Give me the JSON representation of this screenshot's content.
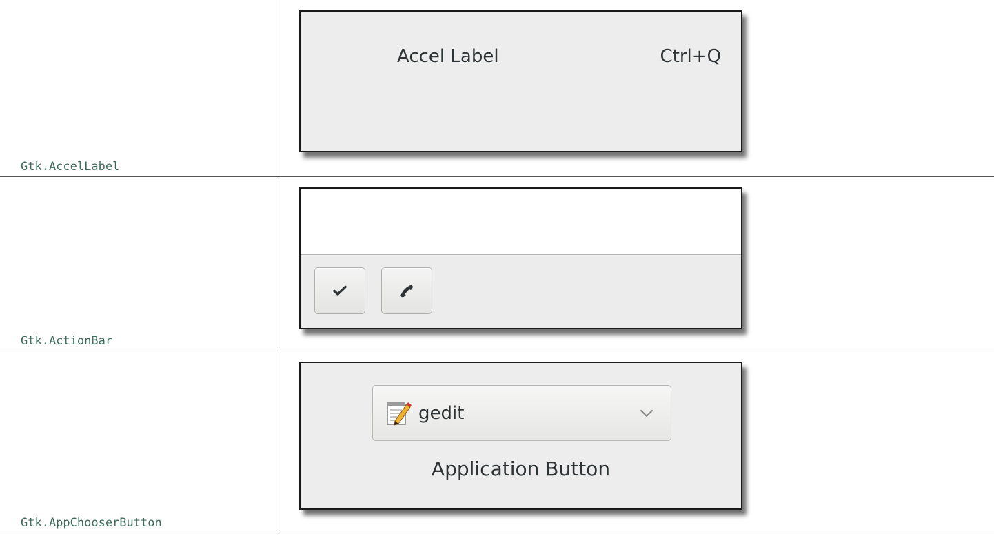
{
  "rows": [
    {
      "widget_name": "Gtk.AccelLabel",
      "accel_label": {
        "label": "Accel Label",
        "accelerator": "Ctrl+Q"
      }
    },
    {
      "widget_name": "Gtk.ActionBar",
      "action_bar": {
        "buttons": [
          {
            "icon": "checkmark-icon"
          },
          {
            "icon": "phone-icon"
          }
        ]
      }
    },
    {
      "widget_name": "Gtk.AppChooserButton",
      "app_chooser": {
        "selected_app": "gedit",
        "app_icon": "text-editor-icon",
        "caption": "Application Button"
      }
    }
  ],
  "colors": {
    "widget_name_text": "#3d6b5c",
    "window_bg": "#ededed",
    "window_border": "#1a1a1a",
    "label_text": "#2e3436",
    "grid_border": "#555555"
  }
}
